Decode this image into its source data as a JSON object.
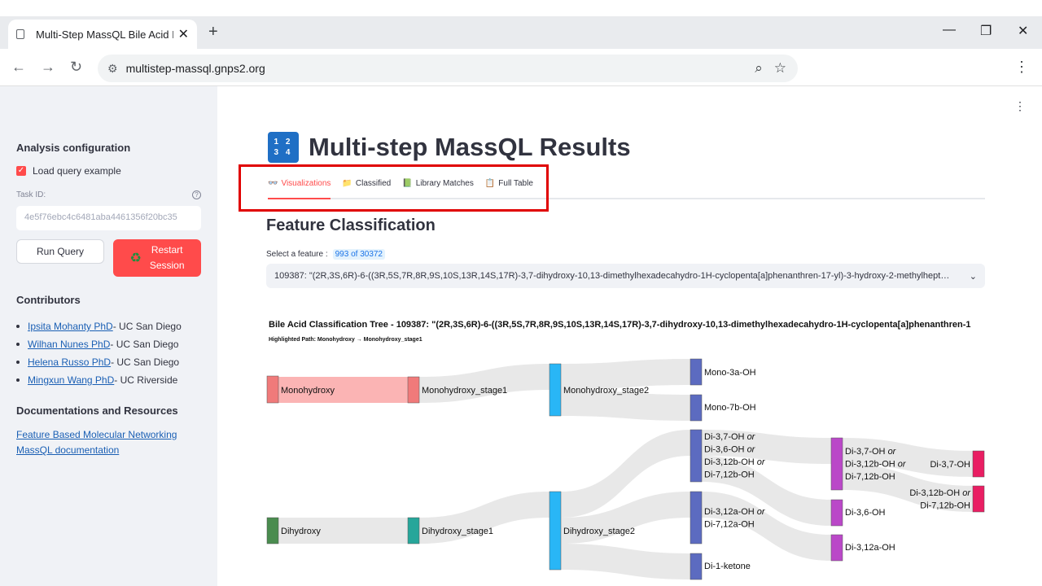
{
  "browser": {
    "tab_title": "Multi-Step MassQL Bile Acid Iso",
    "tab_close": "✕",
    "new_tab": "+",
    "url": "multistep-massql.gnps2.org",
    "controls": {
      "minimize": "—",
      "restore": "❐",
      "close": "✕"
    }
  },
  "sidebar": {
    "heading": "Analysis configuration",
    "load_example_label": "Load query example",
    "task_id_label": "Task ID:",
    "task_id_value": "4e5f76ebc4c6481aba4461356f20bc35",
    "run_button": "Run Query",
    "restart_button_line1": "Restart",
    "restart_button_line2": "Session",
    "contributors_heading": "Contributors",
    "contributors": [
      {
        "name": "Ipsita Mohanty PhD",
        "affil": " - UC San Diego"
      },
      {
        "name": "Wilhan Nunes PhD",
        "affil": " - UC San Diego"
      },
      {
        "name": "Helena Russo PhD",
        "affil": " - UC San Diego"
      },
      {
        "name": "Mingxun Wang PhD",
        "affil": " - UC Riverside"
      }
    ],
    "docs_heading": "Documentations and Resources",
    "docs": [
      "Feature Based Molecular Networking",
      "MassQL documentation"
    ]
  },
  "main": {
    "title_icon": {
      "row1": "1 2",
      "row2": "3 4"
    },
    "title": "Multi-step MassQL Results",
    "tabs": [
      {
        "icon": "👓",
        "label": "Visualizations"
      },
      {
        "icon": "📁",
        "label": "Classified"
      },
      {
        "icon": "📗",
        "label": "Library Matches"
      },
      {
        "icon": "📋",
        "label": "Full Table"
      }
    ],
    "section_heading": "Feature Classification",
    "select_label": "Select a feature :",
    "select_count": "993 of 30372",
    "select_value": "109387: \"(2R,3S,6R)-6-((3R,5S,7R,8R,9S,10S,13R,14S,17R)-3,7-dihydroxy-10,13-dimethylhexadecahydro-1H-cyclopenta[a]phenanthren-17-yl)-3-hydroxy-2-methylhept…"
  },
  "chart_data": {
    "type": "sankey",
    "title": "Bile Acid Classification Tree - 109387: \"(2R,3S,6R)-6-((3R,5S,7R,8R,9S,10S,13R,14S,17R)-3,7-dihydroxy-10,13-dimethylhexadecahydro-1H-cyclopenta[a]phenanthren-1",
    "subtitle": "Highlighted Path: Monohydroxy → Monohydroxy_stage1",
    "nodes": [
      {
        "id": "mono",
        "label": "Monohydroxy",
        "color": "#f07a7a"
      },
      {
        "id": "mono_s1",
        "label": "Monohydroxy_stage1",
        "color": "#f07a7a"
      },
      {
        "id": "mono_s2",
        "label": "Monohydroxy_stage2",
        "color": "#29b6f6"
      },
      {
        "id": "mono3a",
        "label": "Mono-3a-OH",
        "color": "#5c6bc0"
      },
      {
        "id": "mono7b",
        "label": "Mono-7b-OH",
        "color": "#5c6bc0"
      },
      {
        "id": "di",
        "label": "Dihydroxy",
        "color": "#4a8c4f"
      },
      {
        "id": "di_s1",
        "label": "Dihydroxy_stage1",
        "color": "#26a69a"
      },
      {
        "id": "di_s2",
        "label": "Dihydroxy_stage2",
        "color": "#29b6f6"
      },
      {
        "id": "di_a",
        "label": [
          "Di-3,7-OH or",
          "Di-3,6-OH or",
          "Di-3,12b-OH or",
          "Di-7,12b-OH"
        ],
        "color": "#5c6bc0"
      },
      {
        "id": "di_b",
        "label": [
          "Di-3,12a-OH or",
          "Di-7,12a-OH"
        ],
        "color": "#5c6bc0"
      },
      {
        "id": "di_ket",
        "label": "Di-1-ketone",
        "color": "#5c6bc0"
      },
      {
        "id": "di_c",
        "label": [
          "Di-3,7-OH or",
          "Di-3,12b-OH or",
          "Di-7,12b-OH"
        ],
        "color": "#ba48c8"
      },
      {
        "id": "di36",
        "label": "Di-3,6-OH",
        "color": "#ba48c8"
      },
      {
        "id": "di312a",
        "label": "Di-3,12a-OH",
        "color": "#ba48c8"
      },
      {
        "id": "di37",
        "label": "Di-3,7-OH",
        "color": "#e91e63"
      },
      {
        "id": "di_d",
        "label": [
          "Di-3,12b-OH or",
          "Di-7,12b-OH"
        ],
        "color": "#e91e63"
      }
    ],
    "links": [
      {
        "source": "mono",
        "target": "mono_s1",
        "highlight": true
      },
      {
        "source": "mono_s1",
        "target": "mono_s2"
      },
      {
        "source": "mono_s2",
        "target": "mono3a"
      },
      {
        "source": "mono_s2",
        "target": "mono7b"
      },
      {
        "source": "di",
        "target": "di_s1"
      },
      {
        "source": "di_s1",
        "target": "di_s2"
      },
      {
        "source": "di_s2",
        "target": "di_a"
      },
      {
        "source": "di_s2",
        "target": "di_b"
      },
      {
        "source": "di_s2",
        "target": "di_ket"
      },
      {
        "source": "di_a",
        "target": "di_c"
      },
      {
        "source": "di_a",
        "target": "di36"
      },
      {
        "source": "di_b",
        "target": "di312a"
      },
      {
        "source": "di_c",
        "target": "di37"
      },
      {
        "source": "di_c",
        "target": "di_d"
      }
    ]
  }
}
